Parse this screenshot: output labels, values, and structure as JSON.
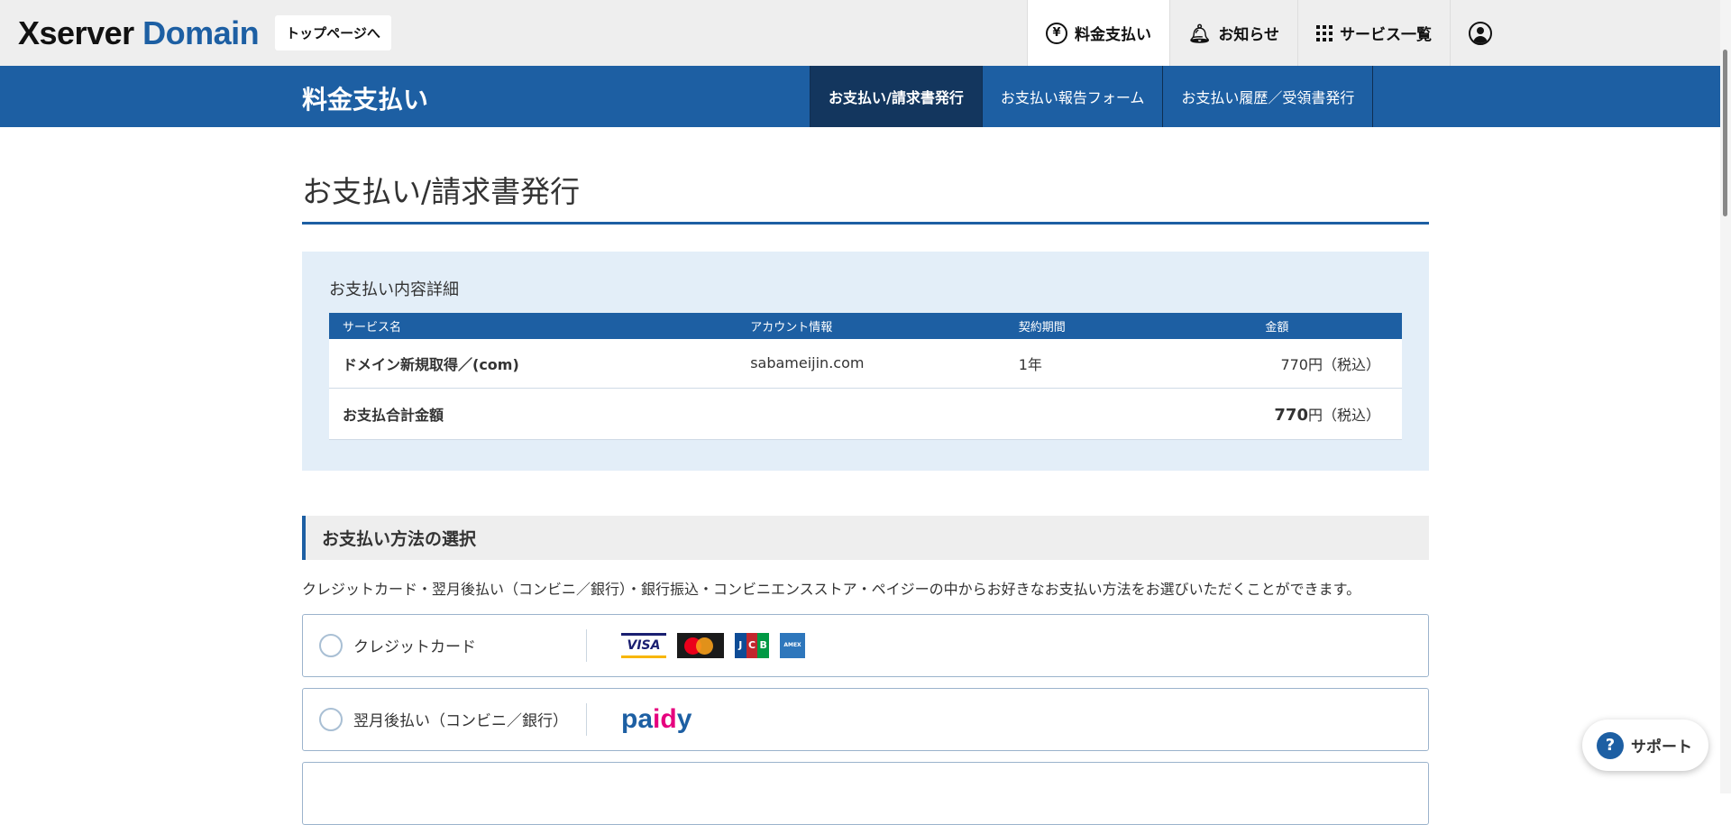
{
  "header": {
    "logo_x": "Xserver",
    "logo_domain": "Domain",
    "top_link": "トップページへ",
    "nav": [
      {
        "label": "料金支払い",
        "icon": "yen-icon"
      },
      {
        "label": "お知らせ",
        "icon": "bell-icon"
      },
      {
        "label": "サービス一覧",
        "icon": "grid-icon"
      },
      {
        "label": "",
        "icon": "user-icon"
      }
    ]
  },
  "subbar": {
    "title": "料金支払い",
    "tabs": [
      "お支払い/請求書発行",
      "お支払い報告フォーム",
      "お支払い履歴／受領書発行"
    ]
  },
  "page_title": "お支払い/請求書発行",
  "detail": {
    "label": "お支払い内容詳細",
    "columns": [
      "サービス名",
      "アカウント情報",
      "契約期間",
      "金額"
    ],
    "rows": [
      {
        "service": "ドメイン新規取得／(com)",
        "account": "sabameijin.com",
        "period": "1年",
        "amount": "770",
        "unit": "円（税込）"
      }
    ],
    "total_label": "お支払合計金額",
    "total_amount": "770",
    "total_unit": "円（税込）"
  },
  "payment": {
    "heading": "お支払い方法の選択",
    "description": "クレジットカード・翌月後払い（コンビニ／銀行）・銀行振込・コンビニエンスストア・ペイジーの中からお好きなお支払い方法をお選びいただくことができます。",
    "options": [
      {
        "label": "クレジットカード",
        "logos": [
          "VISA",
          "Mastercard",
          "JCB",
          "AMEX"
        ]
      },
      {
        "label": "翌月後払い（コンビニ／銀行）",
        "logos": [
          "paidy"
        ]
      }
    ]
  },
  "support": {
    "label": "サポート"
  },
  "colors": {
    "brand": "#1d5fa3",
    "active_tab": "#13365e",
    "detail_bg": "#e3eef8"
  }
}
